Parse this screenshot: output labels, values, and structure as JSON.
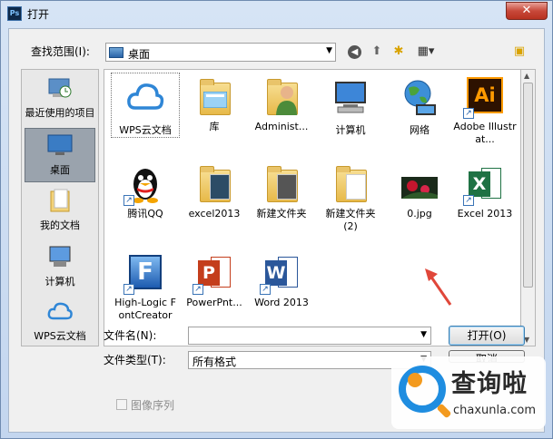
{
  "window": {
    "title": "打开",
    "app_icon": "Ps",
    "close": "✕"
  },
  "toolbar": {
    "lookin_label": "查找范围(I):",
    "lookin_value": "桌面",
    "back_icon": "back-arrow-icon",
    "up_icon": "up-folder-icon",
    "new_folder_icon": "new-folder-icon",
    "view_icon": "view-menu-icon"
  },
  "places": [
    {
      "label": "最近使用的项目",
      "icon": "recent-items-icon"
    },
    {
      "label": "桌面",
      "icon": "desktop-icon",
      "selected": true
    },
    {
      "label": "我的文档",
      "icon": "documents-icon"
    },
    {
      "label": "计算机",
      "icon": "computer-icon"
    },
    {
      "label": "WPS云文档",
      "icon": "cloud-icon"
    }
  ],
  "files": [
    {
      "label": "WPS云文档",
      "icon": "cloud-icon"
    },
    {
      "label": "库",
      "icon": "library-folder-icon"
    },
    {
      "label": "Administ...",
      "icon": "user-folder-icon"
    },
    {
      "label": "计算机",
      "icon": "computer-icon"
    },
    {
      "label": "网络",
      "icon": "network-globe-icon"
    },
    {
      "label": "Adobe Illustrat...",
      "icon": "illustrator-icon"
    },
    {
      "label": "腾讯QQ",
      "icon": "qq-penguin-icon"
    },
    {
      "label": "excel2013",
      "icon": "folder-icon"
    },
    {
      "label": "新建文件夹",
      "icon": "folder-icon"
    },
    {
      "label": "新建文件夹 (2)",
      "icon": "folder-icon"
    },
    {
      "label": "0.jpg",
      "icon": "image-thumbnail-icon"
    },
    {
      "label": "Excel 2013",
      "icon": "excel-icon"
    },
    {
      "label": "High-Logic FontCreator",
      "icon": "fontcreator-icon"
    },
    {
      "label": "PowerPnt...",
      "icon": "powerpoint-icon"
    },
    {
      "label": "Word 2013",
      "icon": "word-icon"
    }
  ],
  "form": {
    "filename_label": "文件名(N):",
    "filename_value": "",
    "filetype_label": "文件类型(T):",
    "filetype_value": "所有格式",
    "open_button": "打开(O)",
    "cancel_button": "取消",
    "sequence_label": "图像序列"
  },
  "watermark": {
    "brand": "查询啦",
    "domain": "chaxunla.com"
  },
  "colors": {
    "accent": "#1f8de0",
    "arrow": "#e0473a",
    "selection": "#9aa3ad"
  }
}
